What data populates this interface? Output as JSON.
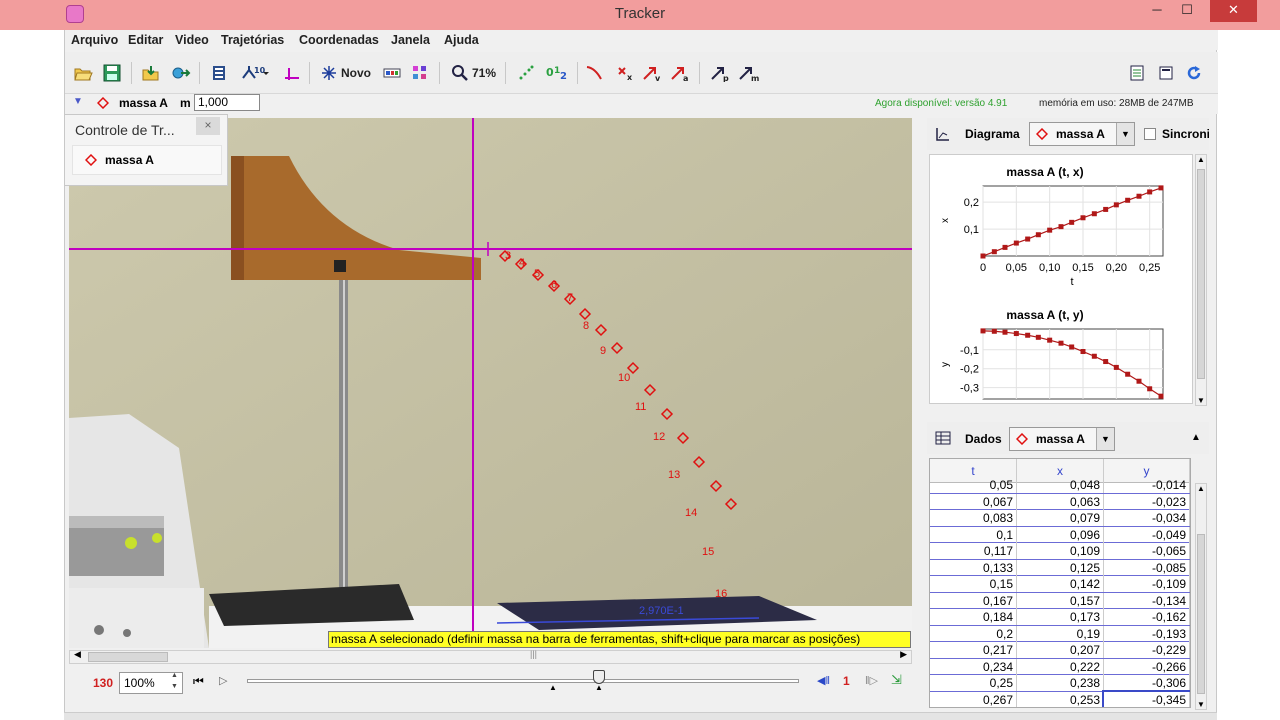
{
  "window": {
    "title": "Tracker",
    "minimize": "─",
    "maximize": "☐",
    "close": "✕"
  },
  "menu": [
    "Arquivo",
    "Editar",
    "Video",
    "Trajetórias",
    "Coordenadas",
    "Janela",
    "Ajuda"
  ],
  "toolbar": {
    "new_label": "Novo",
    "zoom_label": "71%"
  },
  "track": {
    "name": "massa A",
    "mass_label": "m",
    "mass_value": "1,000",
    "update_note": "Agora disponível: versão 4.91",
    "memory_note": "memória em uso: 28MB de 247MB"
  },
  "control_popup": {
    "title": "Controle de Tr...",
    "close": "×",
    "item": "massa A"
  },
  "video": {
    "point_labels": [
      "3",
      "4",
      "5",
      "6",
      "7",
      "8",
      "9",
      "10",
      "11",
      "12",
      "13",
      "14",
      "15",
      "16"
    ],
    "measure_label": "2,970E-1",
    "tooltip": "massa A selecionado (definir massa na barra de ferramentas, shift+clique para marcar as posições)"
  },
  "player": {
    "frame": "130",
    "rate": "100%",
    "step": "1"
  },
  "plot_panel": {
    "header": "Diagrama",
    "track": "massa A",
    "sync_label": "Sincroni",
    "x_chart": {
      "title": "massa A (t, x)",
      "xlabel": "t",
      "ylabel": "x",
      "xticks": [
        "0",
        "0,05",
        "0,10",
        "0,15",
        "0,20",
        "0,25"
      ],
      "yticks": [
        "0,2",
        "0,1"
      ]
    },
    "y_chart": {
      "title": "massa A (t, y)",
      "ylabel": "y",
      "yticks": [
        "-0,1",
        "-0,2",
        "-0,3"
      ]
    }
  },
  "data_panel": {
    "header": "Dados",
    "track": "massa A",
    "columns": [
      "t",
      "x",
      "y"
    ],
    "rows": [
      [
        "0,05",
        "0,048",
        "-0,014"
      ],
      [
        "0,067",
        "0,063",
        "-0,023"
      ],
      [
        "0,083",
        "0,079",
        "-0,034"
      ],
      [
        "0,1",
        "0,096",
        "-0,049"
      ],
      [
        "0,117",
        "0,109",
        "-0,065"
      ],
      [
        "0,133",
        "0,125",
        "-0,085"
      ],
      [
        "0,15",
        "0,142",
        "-0,109"
      ],
      [
        "0,167",
        "0,157",
        "-0,134"
      ],
      [
        "0,184",
        "0,173",
        "-0,162"
      ],
      [
        "0,2",
        "0,19",
        "-0,193"
      ],
      [
        "0,217",
        "0,207",
        "-0,229"
      ],
      [
        "0,234",
        "0,222",
        "-0,266"
      ],
      [
        "0,25",
        "0,238",
        "-0,306"
      ],
      [
        "0,267",
        "0,253",
        "-0,345"
      ]
    ]
  },
  "colors": {
    "titlebar": "#f29d9d",
    "axis": "#c000c0",
    "marker": "#e01010",
    "update_note": "#2fa12f",
    "tooltip": "#ffff24"
  },
  "chart_data": [
    {
      "type": "scatter",
      "title": "massa A (t, x)",
      "xlabel": "t",
      "ylabel": "x",
      "xlim": [
        0,
        0.27
      ],
      "ylim": [
        0,
        0.26
      ],
      "x": [
        0,
        0.017,
        0.033,
        0.05,
        0.067,
        0.083,
        0.1,
        0.117,
        0.133,
        0.15,
        0.167,
        0.184,
        0.2,
        0.217,
        0.234,
        0.25,
        0.267
      ],
      "y": [
        0,
        0.016,
        0.032,
        0.048,
        0.063,
        0.079,
        0.096,
        0.109,
        0.125,
        0.142,
        0.157,
        0.173,
        0.19,
        0.207,
        0.222,
        0.238,
        0.253
      ]
    },
    {
      "type": "scatter",
      "title": "massa A (t, y)",
      "xlabel": "t",
      "ylabel": "y",
      "xlim": [
        0,
        0.27
      ],
      "ylim": [
        -0.36,
        0.01
      ],
      "x": [
        0,
        0.017,
        0.033,
        0.05,
        0.067,
        0.083,
        0.1,
        0.117,
        0.133,
        0.15,
        0.167,
        0.184,
        0.2,
        0.217,
        0.234,
        0.25,
        0.267
      ],
      "y": [
        0,
        -0.002,
        -0.007,
        -0.014,
        -0.023,
        -0.034,
        -0.049,
        -0.065,
        -0.085,
        -0.109,
        -0.134,
        -0.162,
        -0.193,
        -0.229,
        -0.266,
        -0.306,
        -0.345
      ]
    }
  ]
}
